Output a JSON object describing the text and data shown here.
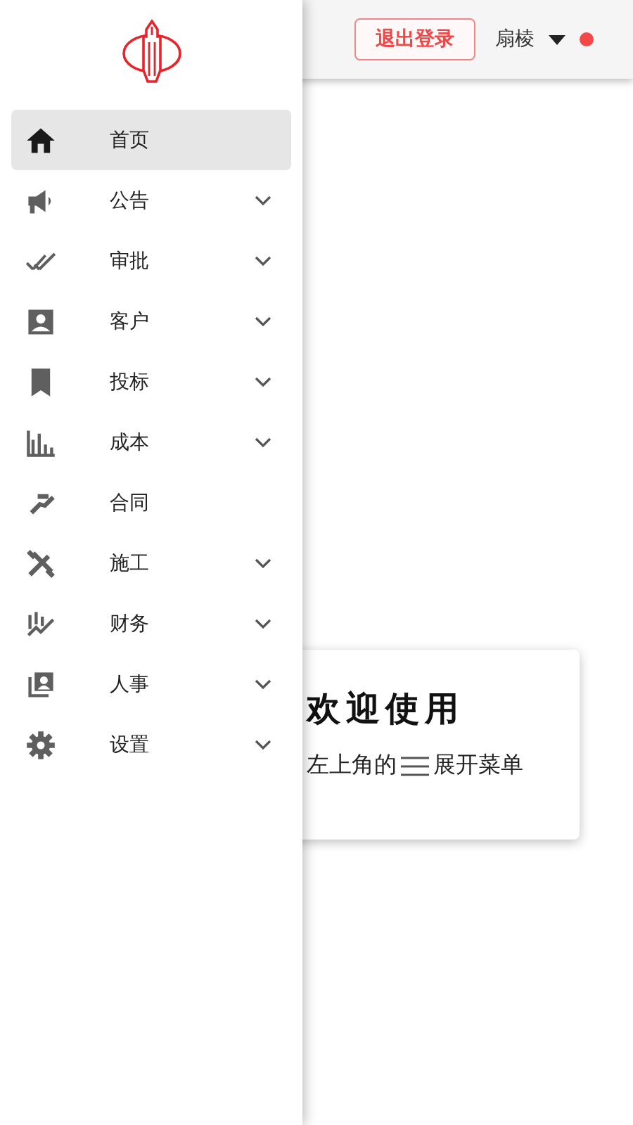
{
  "header": {
    "logout_button": "退出登录",
    "user": {
      "name": "扇棱"
    },
    "notification_dot": {
      "color": "#f44848"
    }
  },
  "sidebar": {
    "items": [
      {
        "label": "首页",
        "selected": true,
        "expandable": false
      },
      {
        "label": "公告",
        "selected": false,
        "expandable": true
      },
      {
        "label": "审批",
        "selected": false,
        "expandable": true
      },
      {
        "label": "客户",
        "selected": false,
        "expandable": true
      },
      {
        "label": "投标",
        "selected": false,
        "expandable": true
      },
      {
        "label": "成本",
        "selected": false,
        "expandable": true
      },
      {
        "label": "合同",
        "selected": false,
        "expandable": false
      },
      {
        "label": "施工",
        "selected": false,
        "expandable": true
      },
      {
        "label": "财务",
        "selected": false,
        "expandable": true
      },
      {
        "label": "人事",
        "selected": false,
        "expandable": true
      },
      {
        "label": "设置",
        "selected": false,
        "expandable": true
      }
    ]
  },
  "welcome_card": {
    "title": "欢迎使用",
    "hint_before": "左上角的",
    "hint_after": "展开菜单"
  }
}
